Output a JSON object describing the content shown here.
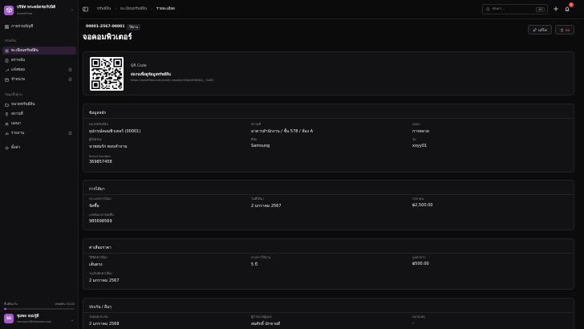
{
  "org": {
    "name": "บริษัท พระคลังเซอร์ปนิติ",
    "subtitle": "AssetFlow"
  },
  "sidebar": {
    "items": [
      {
        "label": "ภาพรวมบัญชี",
        "icon": "grid-icon"
      }
    ],
    "section_assets": "ทรัพย์สิน",
    "asset_items": [
      {
        "label": "ทะเบียนทรัพย์สิน",
        "icon": "list-icon"
      },
      {
        "label": "ตรวจนับ",
        "icon": "clipboard-icon"
      },
      {
        "label": "แจ้งซ่อม",
        "icon": "wrench-icon"
      },
      {
        "label": "จำหน่าย",
        "icon": "box-icon"
      }
    ],
    "section_data": "ข้อมูลพื้นฐาน",
    "data_items": [
      {
        "label": "หมวดทรัพย์สิน",
        "icon": "folder-icon"
      },
      {
        "label": "สถานที่",
        "icon": "pin-icon"
      },
      {
        "label": "แผนก",
        "icon": "users-icon"
      },
      {
        "label": "รายงาน",
        "icon": "chart-icon"
      }
    ],
    "settings": {
      "label": "ตั้งค่า",
      "icon": "gear-icon"
    }
  },
  "storage": {
    "label": "พื้นที่จัดเก็บ",
    "value": "ทรัพย์สิน 3/100",
    "fraction": 0.03
  },
  "user": {
    "initials": "SS",
    "name": "ชุมพล จอมรู้ดี",
    "email": "somporn@thisisero.com"
  },
  "breadcrumb": {
    "root": "ทรัพย์สิน",
    "parent": "ทะเบียนทรัพย์สิน",
    "current": "รายละเอียด"
  },
  "search": {
    "placeholder": "ค้นหา...",
    "shortcut": "⌘K"
  },
  "notifications": {
    "count": "3"
  },
  "asset": {
    "code": "00001-2567-00001",
    "status": "ใช้งาน",
    "title": "จอคอมพิวเตอร์"
  },
  "actions": {
    "edit": "แก้ไข",
    "delete": "ลบ"
  },
  "qr": {
    "title": "QR Code",
    "description": "สแกนเพื่อดูข้อมูลทรัพย์สิน",
    "link": "https://assetflow.com/public-asset/a/1Nps4RNkDQ-_3vKN"
  },
  "general": {
    "title": "ข้อมูลหลัก",
    "fields": [
      {
        "label": "หมวดทรัพย์สิน",
        "value": "อุปกรณ์คอมพิวเตอร์ (00001)"
      },
      {
        "label": "สถานที่",
        "value": "อาคารสำนักงาน / ชั้น 578 / ห้อง A"
      },
      {
        "label": "แผนก",
        "value": "การตลาด"
      },
      {
        "label": "ผู้ถือครอง",
        "value": "นายสมรัก ตอบคำถาม"
      },
      {
        "label": "ยี่ห้อ",
        "value": "Samsung"
      },
      {
        "label": "รุ่น",
        "value": "xxyy01"
      },
      {
        "label": "Serial Number",
        "value": "369857458"
      }
    ]
  },
  "acquisition": {
    "title": "การได้มา",
    "fields": [
      {
        "label": "ประเภทการได้มา",
        "value": "จัดซื้อ"
      },
      {
        "label": "วันที่ได้มา",
        "value": "2 มกราคม 2567"
      },
      {
        "label": "ราคาทุน",
        "value": "฿2,500.00"
      },
      {
        "label": "เลขที่เอกสารจัดซื้อ",
        "value": "985698569"
      }
    ]
  },
  "depreciation": {
    "title": "ค่าเสื่อมราคา",
    "fields": [
      {
        "label": "วิธีคิดค่าเสื่อม",
        "value": "เส้นตรง"
      },
      {
        "label": "อายุการใช้งาน",
        "value": "5 ปี"
      },
      {
        "label": "มูลค่าซาก",
        "value": "฿500.00"
      },
      {
        "label": "วันเริ่มคิดค่าเสื่อม",
        "value": "2 มกราคม 2567"
      }
    ]
  },
  "warranty": {
    "title": "ประกัน / อื่นๆ",
    "fields": [
      {
        "label": "วันหมดประกัน",
        "value": "2 มกราคม 2568"
      },
      {
        "label": "ผู้จำหน่ายผู้ดูแล",
        "value": "สมศักดิ์ นักขายดี"
      },
      {
        "label": "หมายเหตุ",
        "value": "-"
      }
    ]
  }
}
